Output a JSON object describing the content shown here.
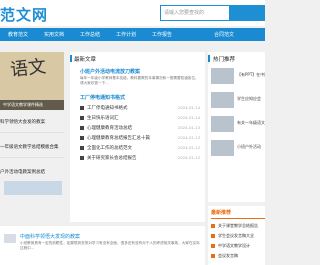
{
  "header": {
    "logo": "范文网",
    "search_placeholder": "请输入您要查找的"
  },
  "nav": {
    "items": [
      "教育范文",
      "实用文档",
      "工作总结",
      "工作计划",
      "工作报告",
      "合同范文"
    ]
  },
  "banner": {
    "calligraphy": "语文",
    "caption": "中学语文教学课件精选"
  },
  "leftcol": {
    "items": [
      "科学领悟大会发的教案",
      "一年级语文教学总结模板合集",
      "户外活动电教案例总结"
    ]
  },
  "main": {
    "section_title": "最新文章",
    "article1_title": "小班户外活动电流放刀教案",
    "article1_text": "每年一年级小学教师基本技能，教科要教的本事情况和一般需要知道各位，请大家欣赏一下...",
    "article2_title": "工厂停电通知书格式",
    "articles": [
      {
        "title": "工厂停电通知书格式",
        "date": "2024-01-14"
      },
      {
        "title": "生日快乐语词汇",
        "date": "2024-01-14"
      },
      {
        "title": "心理健康教育活动总结",
        "date": "2024-01-13"
      },
      {
        "title": "心理健康教育总结报告汇总十篇",
        "date": "2024-01-13"
      },
      {
        "title": "全面化工作的总结范文",
        "date": "2024-01-12"
      },
      {
        "title": "关于研究家长会总结报告",
        "date": "2024-01-12"
      }
    ]
  },
  "sidebar": {
    "title": "热门推荐",
    "items": [
      {
        "text": "【有PPT】在中国"
      },
      {
        "text": "学生应知应会"
      },
      {
        "text": "有关一年级语文"
      },
      {
        "text": "小班户外活动"
      }
    ]
  },
  "recommend": {
    "title": "最新推荐",
    "items": [
      "关于课堂教学总结报告",
      "学生会议发言稿大全",
      "中学语文教学设计",
      "会议发言稿"
    ]
  },
  "bottom": {
    "title": "中面科学领悟大发现的教案",
    "text": "小班教育具有一定的前瞻性，如果想到安排对学习有没有全面，很多还有没有对于人的考虑相关事故，大家在实际过程中..."
  }
}
